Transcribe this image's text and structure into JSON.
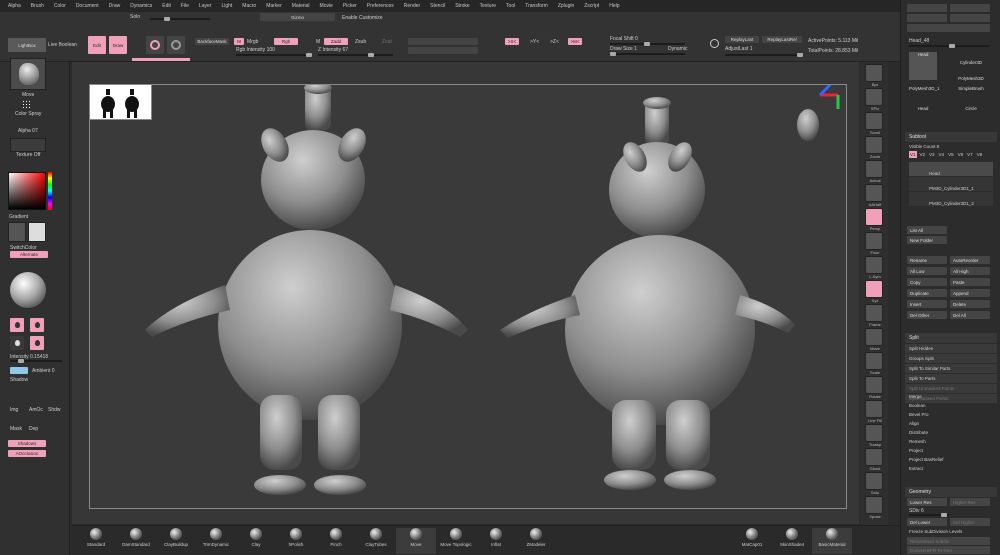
{
  "menu": [
    "Alpha",
    "Brush",
    "Color",
    "Document",
    "Draw",
    "Dynamics",
    "Edit",
    "File",
    "Layer",
    "Light",
    "Macro",
    "Marker",
    "Material",
    "Movie",
    "Picker",
    "Preferences",
    "Render",
    "Stencil",
    "Stroke",
    "Texture",
    "Tool",
    "Transform",
    "Zplugin",
    "Zscript",
    "Help"
  ],
  "top": {
    "solo": "Solo",
    "gizmo": "Gizmo",
    "enable_customize": "Enable Customize",
    "edit": "Edit",
    "draw": "Draw",
    "move": "Move",
    "scale": "Scale",
    "rotate": "Rotate",
    "backface_mask": "BackfaceMask",
    "mrgb": "Mrgb",
    "rgb": "Rgb",
    "m": "M",
    "zadd": "Zadd",
    "zsub": "Zsub",
    "zcut": "Zcut",
    "rgb_intensity": "Rgb Intensity 100",
    "z_intensity": "Z Intensity 67",
    "focal_shift": "Focal Shift 0",
    "draw_size": "Draw Size 1",
    "dynamic": "Dynamic",
    "active_points": "ActivePoints: 5.113 Mil",
    "total_points": "TotalPoints: 28.853 Mil",
    "replay_last": "ReplayLast",
    "replay_last_rel": "ReplayLastRel",
    "adjust_last": "AdjustLast 1",
    "x": ">X<",
    "y": ">Y<",
    "z": ">Z<",
    "m_sym": ">M<"
  },
  "left": {
    "lightbox": "LightBox",
    "live_boolean": "Live Boolean",
    "move_label": "Move",
    "color_spray": "Color Spray",
    "alpha": "Alpha 07",
    "texture_off": "Texture Off",
    "gradient": "Gradient",
    "switch_color": "SwitchColor",
    "alternate": "Alternate",
    "intensity": "Intensity 0.15418",
    "shadow": "Shadow",
    "ambient": "Ambient 0",
    "img": "Img",
    "amb_oc": "AmOc",
    "shdw": "Shdw",
    "mask": "Mask",
    "dep": "Dep",
    "shadows": "Shadows",
    "aocclusion": "AOcclusion"
  },
  "shelf": [
    "Bpr",
    "SPix",
    "Scroll",
    "Zoom",
    "Actual",
    "AAHalf",
    "Persp",
    "Floor",
    "L.Sym",
    "Xyz",
    "Frame",
    "Move",
    "Scale",
    "Rotate",
    "Line Fill",
    "Transp",
    "Ghost",
    "Solo",
    "Xpose"
  ],
  "right": {
    "head": "Head_48",
    "tools": [
      "Head",
      "Cylinder3D",
      "PolyMesh3D",
      "PolyMesh3D_1",
      "SimpleBrush",
      "Head",
      "Circle"
    ],
    "subtool_title": "Subtool",
    "visible_count": "Visible Count 8",
    "vs": [
      "V1",
      "V2",
      "V3",
      "V4",
      "V5",
      "V6",
      "V7",
      "V8"
    ],
    "items": [
      "Head",
      "PM3D_Cylinder3D1_1",
      "PM3D_Cylinder3D1_2"
    ],
    "list_all": "List All",
    "new_folder": "New Folder",
    "ops": [
      "Rename",
      "AutoReorder",
      "All Low",
      "All High",
      "Copy",
      "Paste",
      "Duplicate",
      "Append",
      "Insert",
      "Delete",
      "Del Other",
      "Del All"
    ],
    "split": "Split",
    "split_ops": [
      "Split Hidden",
      "Groups Split",
      "Split To Similar Parts",
      "Split To Parts",
      "Split Unmasked Points",
      "Split Masked Points"
    ],
    "merge_ops": [
      "Merge",
      "Boolean",
      "Bevel Pro",
      "Align",
      "Distribute",
      "Remesh",
      "Project",
      "Project BasRelief",
      "Extract"
    ],
    "geometry": "Geometry",
    "lower_res": "Lower Res",
    "higher_res": "Higher Res",
    "sdiv": "SDiv 6",
    "del_lower": "Del Lower",
    "del_higher": "Del Higher",
    "freeze": "Freeze SubDivision Levels",
    "reconstruct": "Reconstruct Subdiv",
    "convert_bpr": "Convert BPR To Geo"
  },
  "brushes": [
    "Standard",
    "DamStandard",
    "ClayBuildup",
    "TrimDynamic",
    "Clay",
    "hPolish",
    "Pinch",
    "ClayTubes",
    "Move",
    "Move Topologic",
    "Inflat",
    "ZModeler",
    "MatCap01",
    "SkinShade4",
    "BasicMaterial"
  ],
  "colors": {
    "accent": "#f0a0b8",
    "bg": "#2b2b2b",
    "panel": "#303030"
  }
}
